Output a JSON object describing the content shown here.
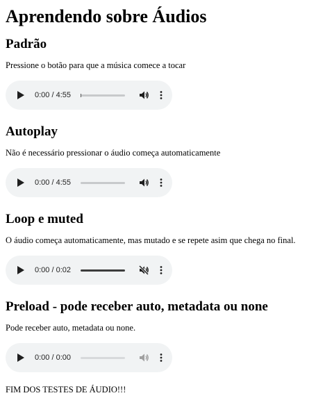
{
  "page_title": "Aprendendo sobre Áudios",
  "sections": [
    {
      "heading": "Padrão",
      "description": "Pressione o botão para que a música comece a tocar",
      "player": {
        "time": "0:00 / 4:55",
        "progress": 0.0,
        "muted": false,
        "disabled": false
      }
    },
    {
      "heading": "Autoplay",
      "description": "Não é necessário pressionar o áudio começa automaticamente",
      "player": {
        "time": "0:00 / 4:55",
        "progress": 0.0,
        "muted": false,
        "disabled": false
      }
    },
    {
      "heading": "Loop e muted",
      "description": "O áudio começa automaticamente, mas mutado e se repete asim que chega no final.",
      "player": {
        "time": "0:00 / 0:02",
        "progress": 1.0,
        "muted": true,
        "disabled": false
      }
    },
    {
      "heading": "Preload - pode receber auto, metadata ou none",
      "description": "Pode receber auto, metadata ou none.",
      "player": {
        "time": "0:00 / 0:00",
        "progress": 0.0,
        "muted": false,
        "disabled": true
      }
    }
  ],
  "footer": "FIM DOS TESTES DE ÁUDIO!!!",
  "icons": {
    "play": "play-icon",
    "volume": "volume-icon",
    "volume_muted": "volume-muted-icon",
    "menu": "more-vert-icon"
  },
  "colors": {
    "player_bg": "#f1f3f4",
    "track": "#c7c9cb",
    "track_filled": "#3c3c3c",
    "disabled_icon": "#a0a0a0"
  }
}
